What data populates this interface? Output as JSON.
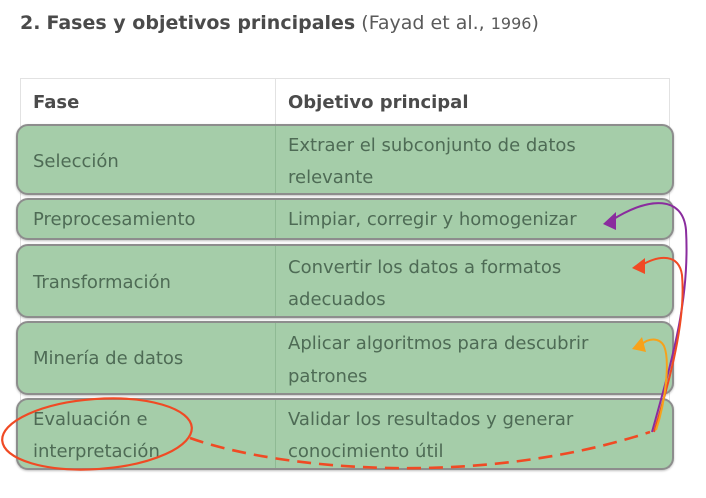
{
  "heading": {
    "number": "2.",
    "title": "Fases y objetivos principales",
    "citation_open": "(Fayad et al., ",
    "citation_year": "1996",
    "citation_close": ")"
  },
  "table": {
    "headers": {
      "phase": "Fase",
      "objective": "Objetivo principal"
    },
    "rows": [
      {
        "phase": [
          "Selección"
        ],
        "objective": [
          "Extraer el subconjunto de datos",
          "relevante"
        ]
      },
      {
        "phase": [
          "Preprocesamiento"
        ],
        "objective": [
          "Limpiar, corregir y homogenizar"
        ]
      },
      {
        "phase": [
          "Transformación"
        ],
        "objective": [
          "Convertir los datos a formatos",
          "adecuados"
        ]
      },
      {
        "phase": [
          "Minería de datos"
        ],
        "objective": [
          "Aplicar algoritmos para descubrir",
          "patrones"
        ]
      },
      {
        "phase": [
          "Evaluación e",
          "interpretación"
        ],
        "objective": [
          "Validar los resultados y generar",
          "conocimiento útil"
        ]
      }
    ]
  },
  "colors": {
    "row_fill": "#a5cda9",
    "row_border": "#8d8d8d",
    "annotation_red": "#f04a24",
    "annotation_purple": "#8a2c9e",
    "annotation_orange": "#f7a21b"
  }
}
